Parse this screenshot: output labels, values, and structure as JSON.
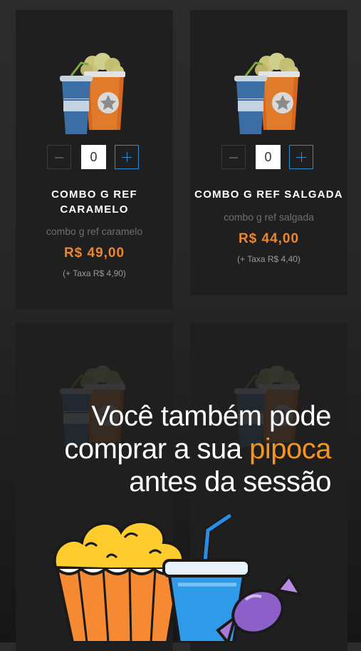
{
  "products": [
    {
      "title": "COMBO G REF CARAMELO",
      "title_l1": "COMBO G REF",
      "title_l2": "CARAMELO",
      "subtitle": "combo g ref caramelo",
      "price": "R$ 49,00",
      "fee": "(+ Taxa R$ 4,90)",
      "quantity": "0",
      "minus_icon": "minus-icon",
      "plus_icon": "plus-icon"
    },
    {
      "title": "COMBO G REF SALGADA",
      "subtitle": "combo g ref salgada",
      "price": "R$ 44,00",
      "fee": "(+ Taxa R$ 4,40)",
      "quantity": "0",
      "minus_icon": "minus-icon",
      "plus_icon": "plus-icon"
    }
  ],
  "promo": {
    "line1": "Você também pode",
    "line2_prefix": "comprar a sua ",
    "line2_highlight": "pipoca",
    "line3": "antes da sessão"
  },
  "colors": {
    "accent_orange": "#f0862a",
    "accent_blue": "#2b8fd1",
    "card_bg": "#1f1f1f"
  }
}
